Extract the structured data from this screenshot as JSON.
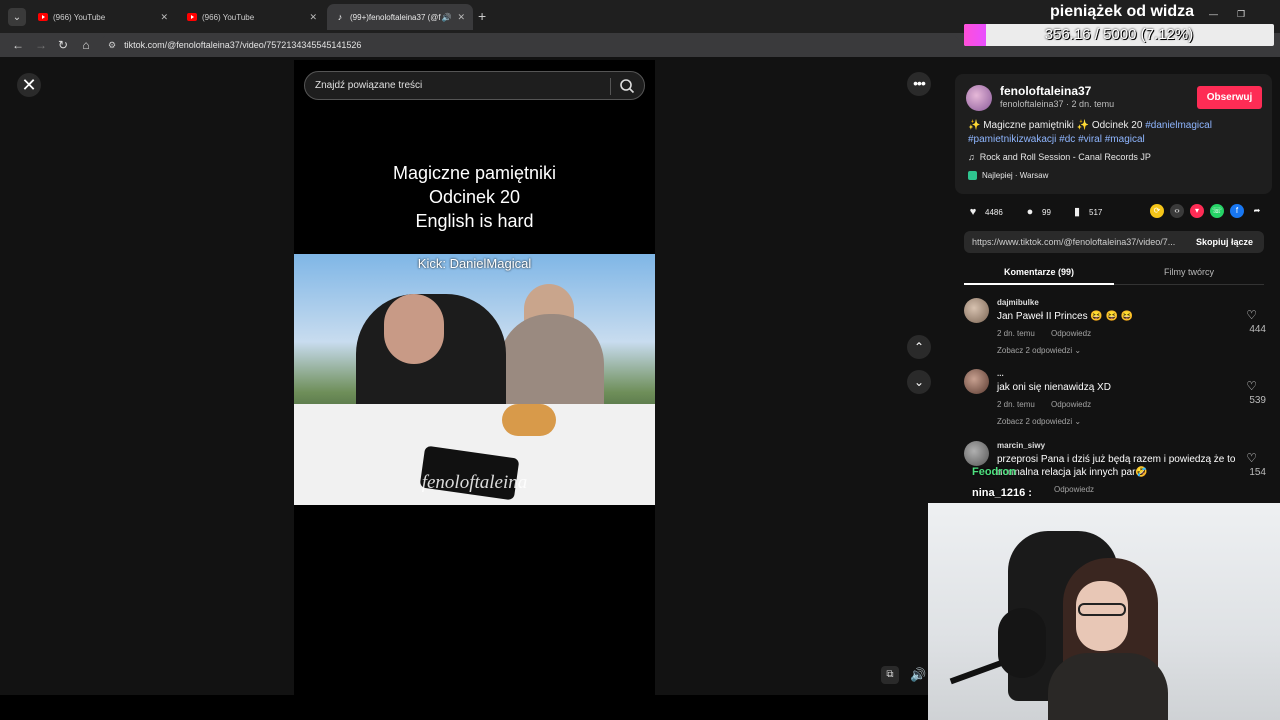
{
  "tabs": [
    {
      "title": "(966) YouTube",
      "type": "youtube"
    },
    {
      "title": "(966) YouTube",
      "type": "youtube"
    },
    {
      "title": "(99+)fenoloftaleina37 (@fe",
      "type": "tiktok"
    }
  ],
  "toolbar": {
    "url": "tiktok.com/@fenoloftaleina37/video/7572134345545141526"
  },
  "overlay": {
    "title": "pieniążek od widza",
    "progress_text": "356.16 / 5000 (7.12%)",
    "progress_fraction": 0.0712,
    "accent": "#ff4fd8"
  },
  "search": {
    "placeholder": "Znajdź powiązane treści"
  },
  "video": {
    "caption_lines": [
      "Magiczne pamiętniki",
      "Odcinek 20",
      "English is hard"
    ],
    "kick_label": "Kick: DanielMagical",
    "watermark": "fenoloftaleina"
  },
  "author": {
    "username": "fenoloftaleina37",
    "meta": "fenoloftaleina37 · 2 dn. temu",
    "follow_label": "Obserwuj",
    "follow_color": "#fe2c55"
  },
  "description": {
    "text": "✨ Magiczne pamiętniki ✨ Odcinek 20 ",
    "tags": [
      "#danielmagical",
      "#pamietnikizwakacji",
      "#dc",
      "#viral",
      "#magical"
    ],
    "music": "Rock and Roll Session - Canal Records JP",
    "location": "Najlepiej · Warsaw"
  },
  "stats": {
    "likes": "4486",
    "comments": "99",
    "saves": "517"
  },
  "share": {
    "link": "https://www.tiktok.com/@fenoloftaleina37/video/7...",
    "copy_label": "Skopiuj łącze"
  },
  "panel_tabs": {
    "comments": "Komentarze (99)",
    "creator_videos": "Filmy twórcy"
  },
  "comments": [
    {
      "user": "dajmibulke",
      "text": "Jan Paweł II Princes 😆 😆 😆",
      "time": "2 dn. temu",
      "reply": "Odpowiedz",
      "more": "Zobacz 2 odpowiedzi ⌄",
      "likes": "444"
    },
    {
      "user": "...",
      "text": "jak oni się nienawidzą XD",
      "time": "2 dn. temu",
      "reply": "Odpowiedz",
      "more": "Zobacz 2 odpowiedzi ⌄",
      "likes": "539"
    },
    {
      "user": "marcin_siwy",
      "text": "przeprosi Pana i dziś już będą razem i powiedzą że to normalna relacja jak innych par🤣",
      "time": "",
      "reply": "Odpowiedz",
      "more": "",
      "likes": "154"
    }
  ],
  "chat": [
    {
      "user": "Feodron"
    },
    {
      "user": "nina_1216 :"
    }
  ]
}
